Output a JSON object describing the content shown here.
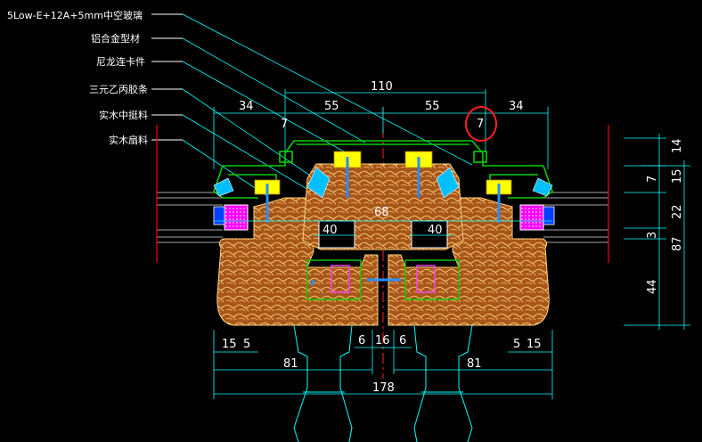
{
  "drawing": {
    "labels": [
      "5Low-E+12A+5mm中空玻璃",
      "铝合金型材",
      "尼龙连卡件",
      "三元乙丙胶条",
      "实木中挺料",
      "实木扇料"
    ],
    "dims_top": {
      "total": "110",
      "left_34": "34",
      "left_55": "55",
      "right_55": "55",
      "right_34": "34",
      "left_7": "7",
      "right_7": "7",
      "inner_68": "68",
      "left_40": "40",
      "right_40": "40"
    },
    "dims_bottom": {
      "left_15": "15",
      "left_5": "5",
      "mid_6a": "6",
      "mid_16": "16",
      "mid_6b": "6",
      "right_5": "5",
      "right_15": "15",
      "left_81": "81",
      "right_81": "81",
      "total_178": "178"
    },
    "dims_right": {
      "d14": "14",
      "d7": "7",
      "d15": "15",
      "d22": "22",
      "d3": "3",
      "d44": "44",
      "d87": "87"
    },
    "colors": {
      "background": "#000000",
      "dim_lines": "#00ffff",
      "wood_fill": "#b5641b",
      "wood_grain": "#ffd27a",
      "aluminum": "#00d000",
      "gasket": "#ff00ff",
      "glass": "#a8a8a8",
      "fixing": "#ffff00",
      "axis": "#ff0000",
      "highlight": "#ff2020"
    }
  }
}
